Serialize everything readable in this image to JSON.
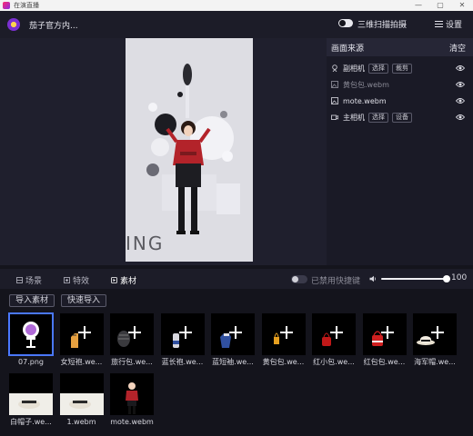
{
  "window": {
    "title": "在演直播",
    "controls": [
      "minimize-icon",
      "maximize-icon",
      "close-icon"
    ]
  },
  "header": {
    "channel_name": "茄子官方内...",
    "scan_label": "三维扫描拍摄",
    "settings_label": "设置"
  },
  "preview": {
    "overlay_text": "ING"
  },
  "sources": {
    "title": "画面来源",
    "clear_label": "清空",
    "items": [
      {
        "name": "副相机",
        "icon": "camera-icon",
        "buttons": [
          "选择",
          "裁剪"
        ],
        "dim": false
      },
      {
        "name": "黄包包.webm",
        "icon": "image-icon",
        "buttons": [],
        "dim": true
      },
      {
        "name": "mote.webm",
        "icon": "image-icon",
        "buttons": [],
        "dim": false
      },
      {
        "name": "主相机",
        "icon": "video-camera-icon",
        "buttons": [
          "选择",
          "设备"
        ],
        "dim": false
      }
    ]
  },
  "tabs": [
    {
      "label": "场景",
      "icon": "scene-icon",
      "active": false
    },
    {
      "label": "特效",
      "icon": "effect-icon",
      "active": false
    },
    {
      "label": "素材",
      "icon": "material-icon",
      "active": true
    }
  ],
  "hotkey_label": "已禁用快捷键",
  "volume": {
    "value": 100,
    "label": "100"
  },
  "actions": {
    "import_label": "导入素材",
    "quick_import_label": "快速导入"
  },
  "materials": [
    {
      "label": "07.png",
      "kind": "logo",
      "selected": true
    },
    {
      "label": "女短袍.we...",
      "kind": "shirt",
      "selected": false
    },
    {
      "label": "旅行包.we...",
      "kind": "bag-dark",
      "selected": false
    },
    {
      "label": "蓝长袍.we...",
      "kind": "bottle",
      "selected": false
    },
    {
      "label": "蓝短袖.we...",
      "kind": "shirt-blue",
      "selected": false
    },
    {
      "label": "黄包包.we...",
      "kind": "bag-yellow",
      "selected": false
    },
    {
      "label": "红小包.we...",
      "kind": "bag-red-small",
      "selected": false
    },
    {
      "label": "红包包.we...",
      "kind": "bag-red",
      "selected": false
    },
    {
      "label": "海军帽.we...",
      "kind": "hat",
      "selected": false
    },
    {
      "label": "白帽子.we...",
      "kind": "white-hat",
      "selected": false
    },
    {
      "label": "1.webm",
      "kind": "white-hat",
      "selected": false
    },
    {
      "label": "mote.webm",
      "kind": "model",
      "selected": false
    }
  ],
  "colors": {
    "accent": "#4a78ff",
    "background": "#14141c",
    "panel": "#1a1a26"
  }
}
